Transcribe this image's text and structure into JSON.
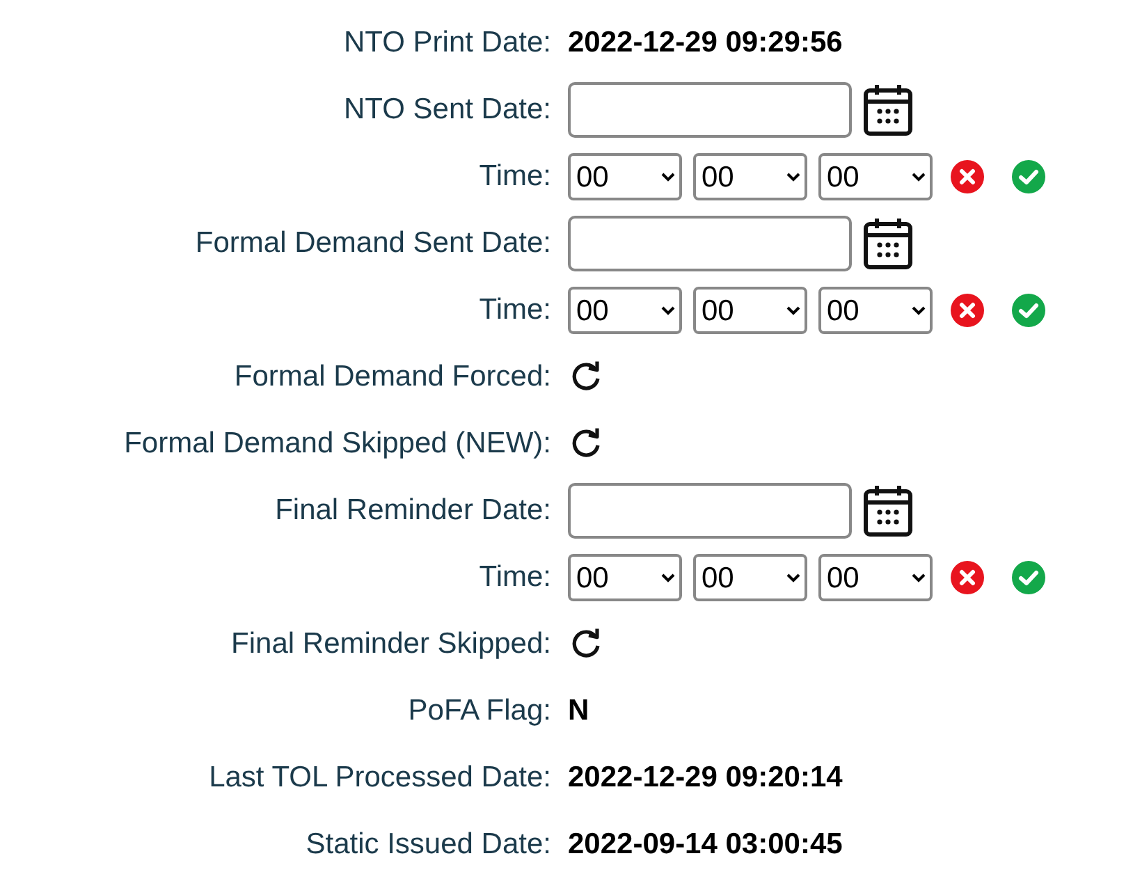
{
  "rows": [
    {
      "kind": "text",
      "label": "NTO Print Date:",
      "value": "2022-12-29 09:29:56"
    },
    {
      "kind": "date",
      "label": "NTO Sent Date:"
    },
    {
      "kind": "time",
      "label": "Time:",
      "selects": [
        "00",
        "00",
        "00"
      ]
    },
    {
      "kind": "date",
      "label": "Formal Demand Sent Date:"
    },
    {
      "kind": "time",
      "label": "Time:",
      "selects": [
        "00",
        "00",
        "00"
      ]
    },
    {
      "kind": "reset",
      "label": "Formal Demand Forced:"
    },
    {
      "kind": "reset",
      "label": "Formal Demand Skipped (NEW):"
    },
    {
      "kind": "date",
      "label": "Final Reminder Date:"
    },
    {
      "kind": "time",
      "label": "Time:",
      "selects": [
        "00",
        "00",
        "00"
      ]
    },
    {
      "kind": "reset",
      "label": "Final Reminder Skipped:"
    },
    {
      "kind": "text",
      "label": "PoFA Flag:",
      "value": "N"
    },
    {
      "kind": "text",
      "label": "Last TOL Processed Date:",
      "value": "2022-12-29 09:20:14"
    },
    {
      "kind": "text",
      "label": "Static Issued Date:",
      "value": "2022-09-14 03:00:45"
    }
  ]
}
